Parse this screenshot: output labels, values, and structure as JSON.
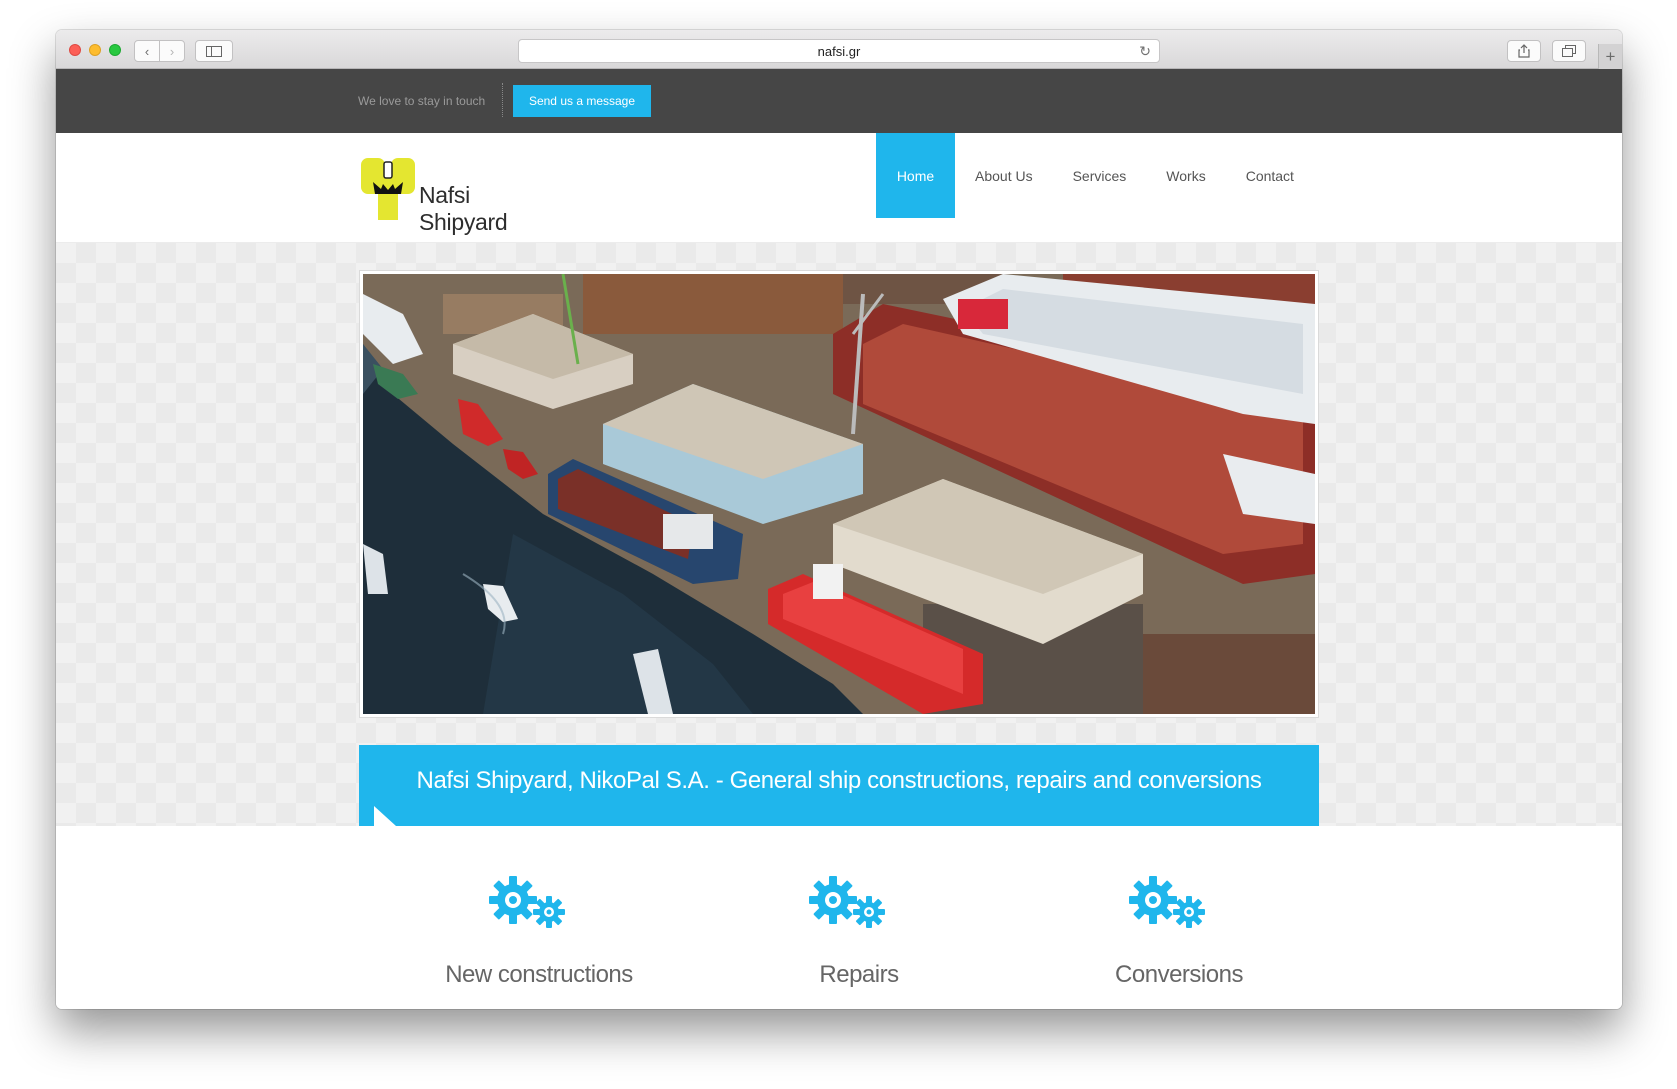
{
  "browser": {
    "url": "nafsi.gr"
  },
  "topbar": {
    "text": "We love to stay in touch",
    "button": "Send us a message"
  },
  "header": {
    "logo_text": "Nafsi Shipyard",
    "nav": [
      "Home",
      "About Us",
      "Services",
      "Works",
      "Contact"
    ],
    "active_nav": "Home"
  },
  "hero": {
    "tagline": "Nafsi Shipyard, NikoPal S.A. - General ship constructions, repairs and conversions"
  },
  "services": [
    {
      "title": "New constructions",
      "icon": "gears-icon"
    },
    {
      "title": "Repairs",
      "icon": "gears-icon"
    },
    {
      "title": "Conversions",
      "icon": "gears-icon"
    }
  ],
  "colors": {
    "accent": "#1fb6ec",
    "topbar": "#464646",
    "logo_yellow": "#e4e630"
  }
}
